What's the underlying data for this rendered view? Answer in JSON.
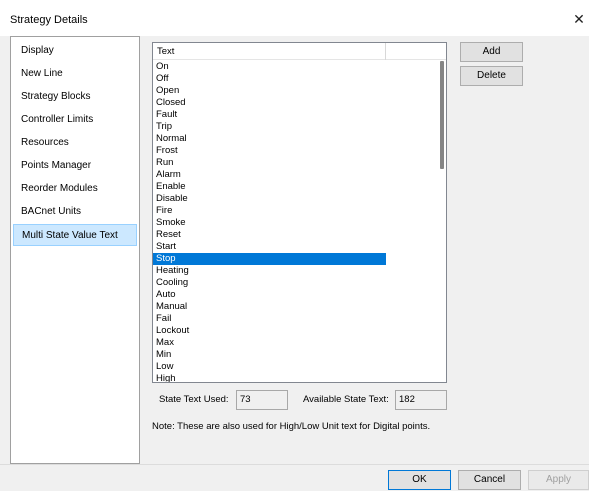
{
  "window": {
    "title": "Strategy Details",
    "close_glyph": "✕"
  },
  "sidebar": {
    "items": [
      {
        "label": "Display"
      },
      {
        "label": "New Line"
      },
      {
        "label": "Strategy Blocks"
      },
      {
        "label": "Controller Limits"
      },
      {
        "label": "Resources"
      },
      {
        "label": "Points Manager"
      },
      {
        "label": "Reorder Modules"
      },
      {
        "label": "BACnet Units"
      },
      {
        "label": "Multi State Value Text",
        "selected": true
      }
    ]
  },
  "list": {
    "header": "Text",
    "rows": [
      "On",
      "Off",
      "Open",
      "Closed",
      "Fault",
      "Trip",
      "Normal",
      "Frost",
      "Run",
      "Alarm",
      "Enable",
      "Disable",
      "Fire",
      "Smoke",
      "Reset",
      "Start",
      "Stop",
      "Heating",
      "Cooling",
      "Auto",
      "Manual",
      "Fail",
      "Lockout",
      "Max",
      "Min",
      "Low",
      "High"
    ],
    "selected_row": "Stop"
  },
  "buttons": {
    "add": "Add",
    "delete": "Delete",
    "ok": "OK",
    "cancel": "Cancel",
    "apply": "Apply"
  },
  "stats": {
    "used_label": "State Text Used:",
    "used_value": "73",
    "available_label": "Available State Text:",
    "available_value": "182"
  },
  "note": "Note: These are also used for High/Low Unit text for Digital points."
}
